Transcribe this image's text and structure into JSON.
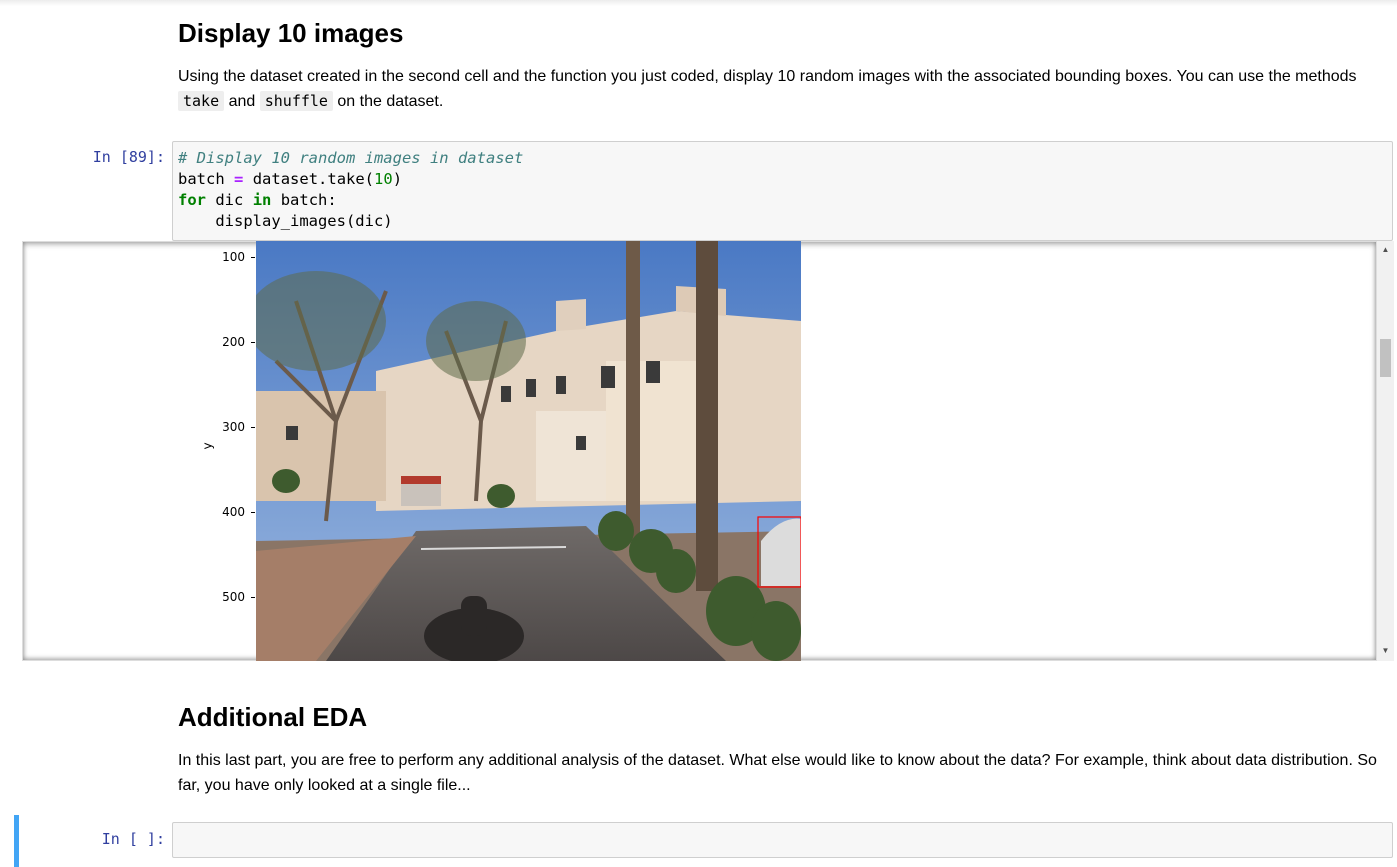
{
  "section1": {
    "heading": "Display 10 images",
    "paragraph_part1": "Using the dataset created in the second cell and the function you just coded, display 10 random images with the associated bounding boxes. You can use the methods",
    "code_take": "take",
    "word_and": "and",
    "code_shuffle": "shuffle",
    "paragraph_part2": "on the dataset."
  },
  "cell89": {
    "prompt": "In [89]:",
    "line1_comment": "# Display 10 random images in dataset",
    "line2_var": "batch",
    "line2_op": "=",
    "line2_call": "dataset.take(",
    "line2_num": "10",
    "line2_close": ")",
    "line3_for": "for",
    "line3_var": "dic",
    "line3_in": "in",
    "line3_rest": "batch:",
    "line4": "    display_images(dic)"
  },
  "plot": {
    "ylabel": "y",
    "yticks": [
      "100",
      "200",
      "300",
      "400",
      "500"
    ],
    "bbox_color": "#ff0000"
  },
  "section2": {
    "heading": "Additional EDA",
    "paragraph": "In this last part, you are free to perform any additional analysis of the dataset. What else would like to know about the data? For example, think about data distribution. So far, you have only looked at a single file..."
  },
  "empty_cell": {
    "prompt": "In [ ]:"
  },
  "scrollbar": {
    "up_arrow": "▲",
    "down_arrow": "▼"
  },
  "colors": {
    "prompt": "#303f9f",
    "selected_cell_bar": "#42a5f5"
  }
}
